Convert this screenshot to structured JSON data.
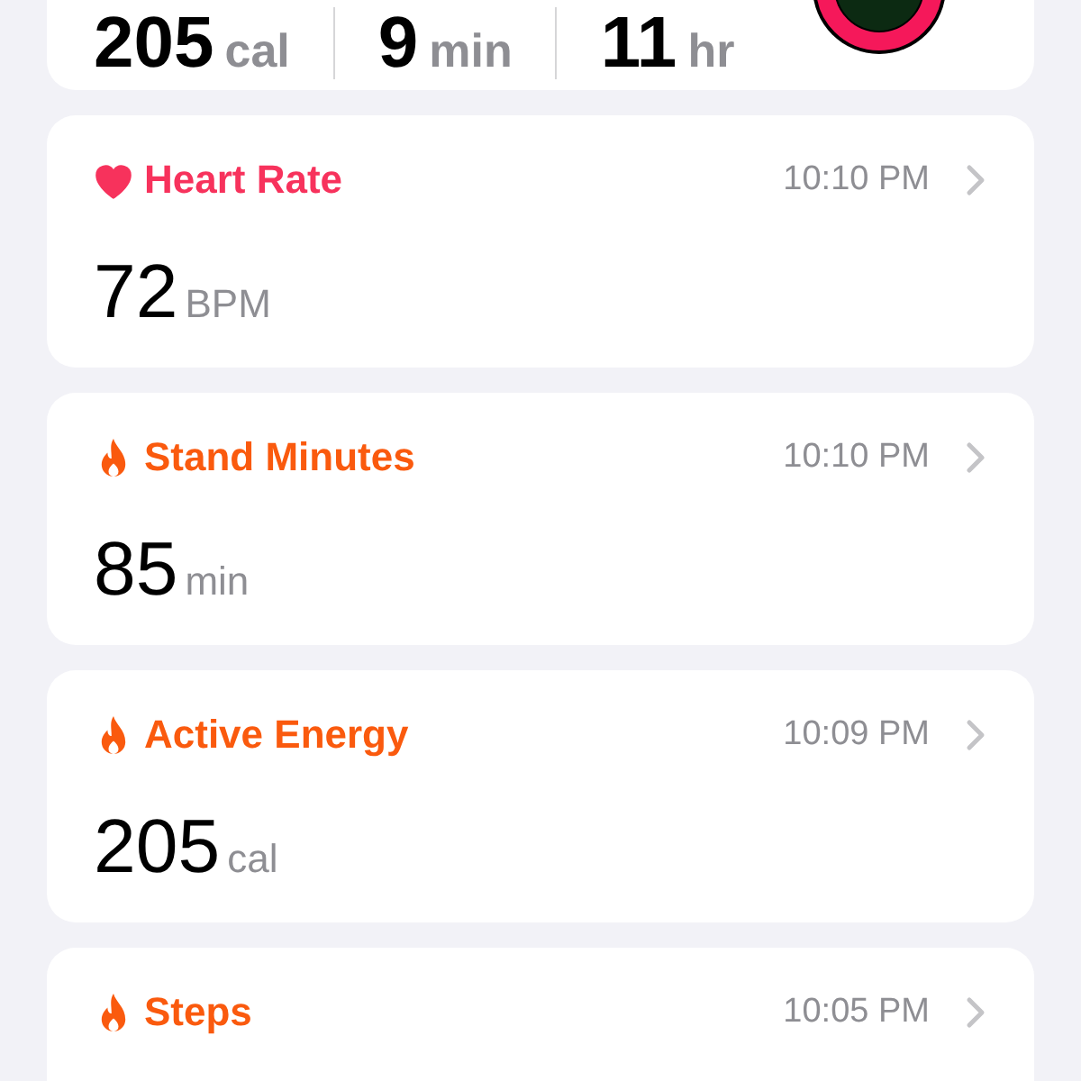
{
  "summary": {
    "metrics": [
      {
        "value": "205",
        "unit": "cal"
      },
      {
        "value": "9",
        "unit": "min"
      },
      {
        "value": "11",
        "unit": "hr"
      }
    ]
  },
  "cards": [
    {
      "kind": "heart",
      "color": "#f7325c",
      "title": "Heart Rate",
      "time": "10:10 PM",
      "value": "72",
      "unit": "BPM"
    },
    {
      "kind": "flame",
      "color": "#fa5a0e",
      "title": "Stand Minutes",
      "time": "10:10 PM",
      "value": "85",
      "unit": "min"
    },
    {
      "kind": "flame",
      "color": "#fa5a0e",
      "title": "Active Energy",
      "time": "10:09 PM",
      "value": "205",
      "unit": "cal"
    },
    {
      "kind": "flame",
      "color": "#fa5a0e",
      "title": "Steps",
      "time": "10:05 PM"
    }
  ]
}
